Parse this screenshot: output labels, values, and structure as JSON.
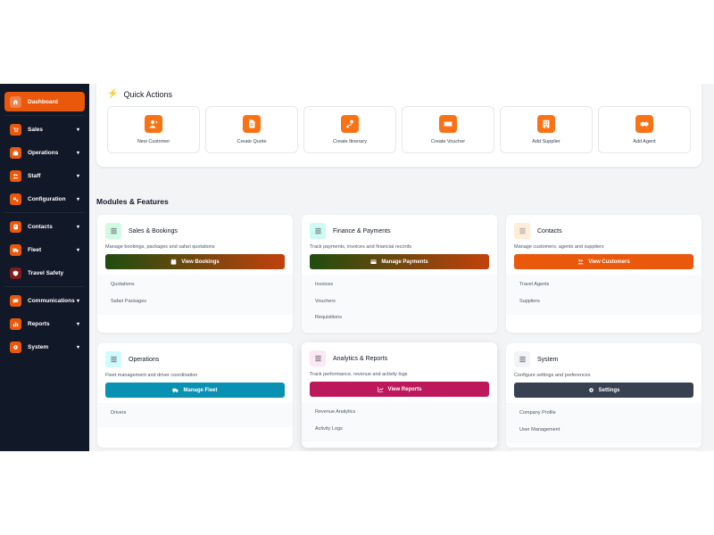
{
  "sidebar": {
    "items": [
      {
        "label": "Dashboard",
        "icon": "home-icon",
        "caret": ""
      },
      {
        "label": "Sales",
        "icon": "cart-icon",
        "caret": "▾"
      },
      {
        "label": "Operations",
        "icon": "briefcase-icon",
        "caret": "▾"
      },
      {
        "label": "Staff",
        "icon": "users-icon",
        "caret": "▾"
      },
      {
        "label": "Configuration",
        "icon": "cogs-icon",
        "caret": "▾"
      },
      {
        "label": "Contacts",
        "icon": "address-book-icon",
        "caret": "▾"
      },
      {
        "label": "Fleet",
        "icon": "truck-icon",
        "caret": "▾"
      },
      {
        "label": "Travel Safety",
        "icon": "shield-icon",
        "caret": ""
      },
      {
        "label": "Communications",
        "icon": "chat-icon",
        "caret": "▾"
      },
      {
        "label": "Reports",
        "icon": "chart-icon",
        "caret": "▾"
      },
      {
        "label": "System",
        "icon": "gear-icon",
        "caret": "▾"
      }
    ]
  },
  "quick_actions": {
    "title": "Quick Actions",
    "items": [
      {
        "label": "New Customer",
        "icon": "user-plus-icon"
      },
      {
        "label": "Create Quote",
        "icon": "file-icon"
      },
      {
        "label": "Create Itinerary",
        "icon": "route-icon"
      },
      {
        "label": "Create Voucher",
        "icon": "ticket-icon"
      },
      {
        "label": "Add Supplier",
        "icon": "building-icon"
      },
      {
        "label": "Add Agent",
        "icon": "handshake-icon"
      }
    ]
  },
  "modules": {
    "title": "Modules & Features",
    "items": [
      {
        "title": "Sales & Bookings",
        "desc": "Manage bookings, packages and safari quotations",
        "button": "View Bookings",
        "links": [
          "Quotations",
          "Safari Packages"
        ]
      },
      {
        "title": "Finance & Payments",
        "desc": "Track payments, invoices and financial records",
        "button": "Manage Payments",
        "links": [
          "Invoices",
          "Vouchers",
          "Requisitions"
        ]
      },
      {
        "title": "Contacts",
        "desc": "Manage customers, agents and suppliers",
        "button": "View Customers",
        "links": [
          "Travel Agents",
          "Suppliers"
        ]
      },
      {
        "title": "Operations",
        "desc": "Fleet management and driver coordination",
        "button": "Manage Fleet",
        "links": [
          "Drivers"
        ]
      },
      {
        "title": "Analytics & Reports",
        "desc": "Track performance, revenue and activity logs",
        "button": "View Reports",
        "links": [
          "Revenue Analytics",
          "Activity Logs"
        ]
      },
      {
        "title": "System",
        "desc": "Configure settings and preferences",
        "button": "Settings",
        "links": [
          "Company Profile",
          "User Management"
        ]
      }
    ]
  },
  "colors": {
    "sidebar_bg": "#111827",
    "accent": "#ea580c",
    "quick_icon": "#f97316",
    "teal": "#0891b2",
    "pink": "#be185d",
    "slate": "#374151"
  }
}
